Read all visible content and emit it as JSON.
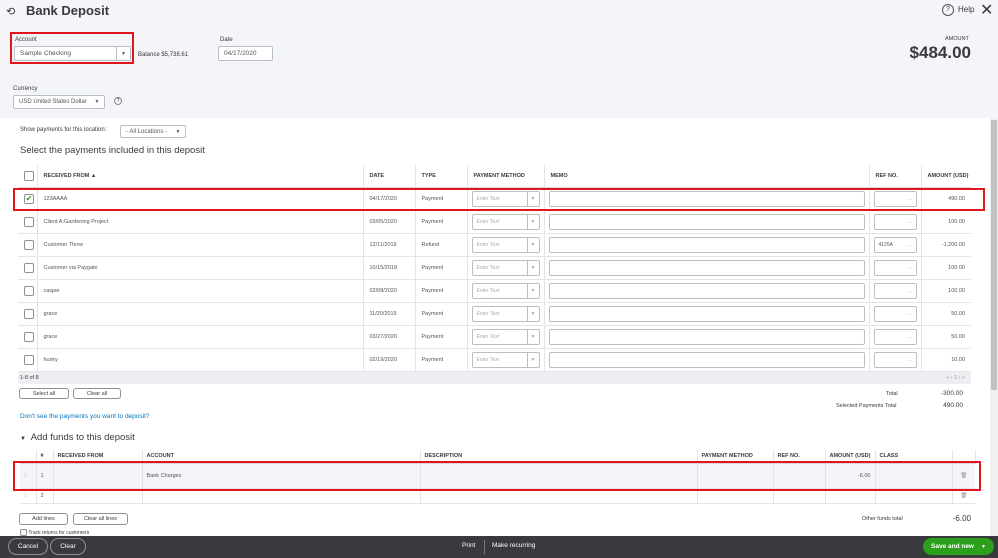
{
  "header": {
    "title": "Bank Deposit",
    "help": "Help",
    "amount_label": "AMOUNT",
    "amount": "$484.00"
  },
  "account": {
    "label": "Account",
    "value": "Sample Checking",
    "balance": "Balance $5,738.61"
  },
  "date": {
    "label": "Date",
    "value": "04/17/2020"
  },
  "currency": {
    "label": "Currency",
    "value": "USD United States Dollar"
  },
  "location": {
    "label": "Show payments for this location:",
    "value": "- All Locations -"
  },
  "payments": {
    "heading": "Select the payments included in this deposit",
    "columns": [
      "RECEIVED FROM ▲",
      "DATE",
      "TYPE",
      "PAYMENT METHOD",
      "MEMO",
      "REF NO.",
      "AMOUNT (USD)"
    ],
    "placeholder": "Enter Text",
    "rows": [
      {
        "checked": true,
        "from": "123AAAA",
        "date": "04/17/2020",
        "type": "Payment",
        "ref": "",
        "amount": "490.00"
      },
      {
        "checked": false,
        "from": "Client A:Gardening Project",
        "date": "03/05/2020",
        "type": "Payment",
        "ref": "",
        "amount": "100.00"
      },
      {
        "checked": false,
        "from": "Customer Three",
        "date": "12/11/2019",
        "type": "Refund",
        "ref": "4125A",
        "amount": "-1,200.00"
      },
      {
        "checked": false,
        "from": "Customer via Paygate",
        "date": "10/15/2018",
        "type": "Payment",
        "ref": "",
        "amount": "100.00"
      },
      {
        "checked": false,
        "from": "casper",
        "date": "02/08/2020",
        "type": "Payment",
        "ref": "",
        "amount": "100.00"
      },
      {
        "checked": false,
        "from": "grace",
        "date": "11/20/2019",
        "type": "Payment",
        "ref": "",
        "amount": "50.00"
      },
      {
        "checked": false,
        "from": "grace",
        "date": "03/27/2020",
        "type": "Payment",
        "ref": "",
        "amount": "50.00"
      },
      {
        "checked": false,
        "from": "husky",
        "date": "02/19/2020",
        "type": "Payment",
        "ref": "",
        "amount": "10.00"
      }
    ],
    "range": "1-8 of 8",
    "pager": "« ‹ 1 › »",
    "select_all": "Select all",
    "clear_all": "Clear all",
    "total_label": "Total",
    "total": "-300.00",
    "selected_label": "Selected Payments Total",
    "selected_total": "490.00",
    "missing_link": "Don't see the payments you want to deposit?"
  },
  "funds": {
    "heading": "Add funds to this deposit",
    "columns": [
      "#",
      "RECEIVED FROM",
      "ACCOUNT",
      "DESCRIPTION",
      "PAYMENT METHOD",
      "REF NO.",
      "AMOUNT (USD)",
      "CLASS"
    ],
    "rows": [
      {
        "num": "1",
        "from": "",
        "account": "Bank Charges",
        "description": "",
        "method": "",
        "ref": "",
        "amount": "-6.00",
        "class": ""
      },
      {
        "num": "2",
        "from": "",
        "account": "",
        "description": "",
        "method": "",
        "ref": "",
        "amount": "",
        "class": ""
      }
    ],
    "add_lines": "Add lines",
    "clear_all_lines": "Clear all lines",
    "other_total_label": "Other funds total",
    "other_total": "-6.00",
    "track_returns": "Track returns for customers"
  },
  "footer": {
    "cancel": "Cancel",
    "clear": "Clear",
    "print": "Print",
    "recurring": "Make recurring",
    "save": "Save and new"
  },
  "colors": {
    "accent": "#2ca01c",
    "link": "#0077c5",
    "highlight": "#e0161c",
    "footer": "#393a3d"
  }
}
